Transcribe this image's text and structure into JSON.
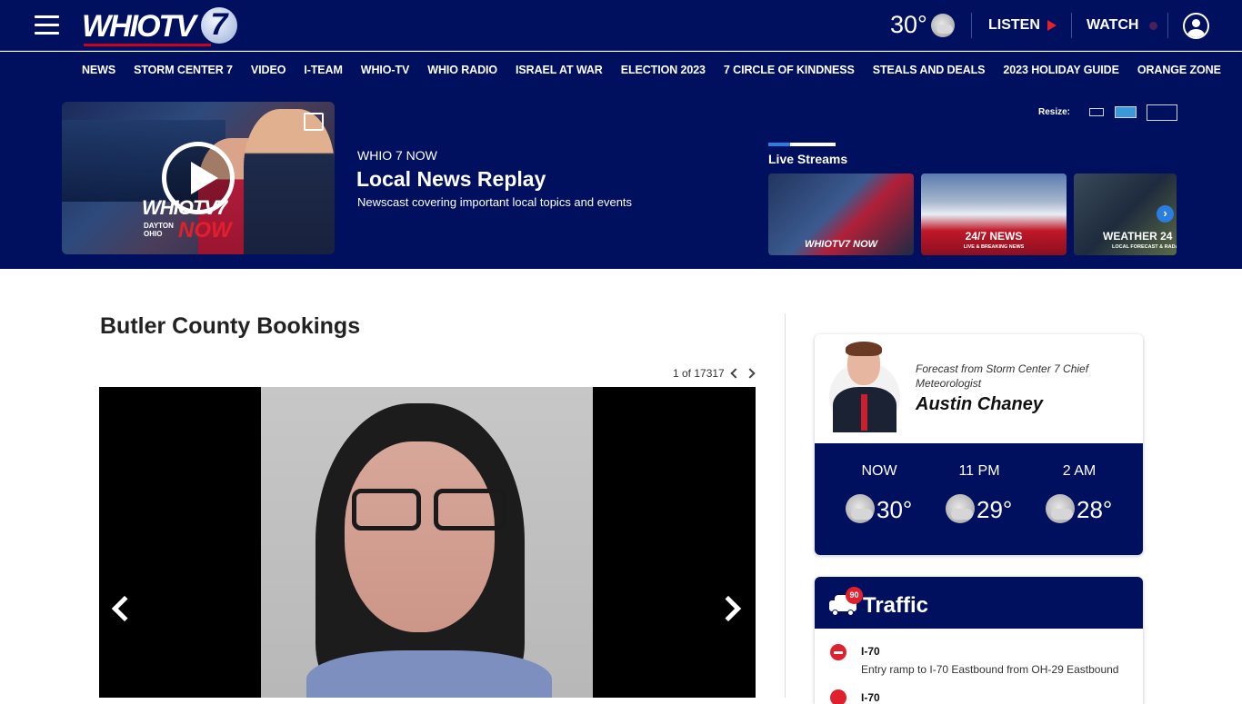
{
  "header": {
    "logo_text": "WHIOTV",
    "logo_number": "7",
    "temperature": "30°",
    "listen_label": "LISTEN",
    "watch_label": "WATCH",
    "accent_color": "#e5202a",
    "bg_color": "#00105e"
  },
  "nav": {
    "items": [
      "NEWS",
      "STORM CENTER 7",
      "VIDEO",
      "I-TEAM",
      "WHIO-TV",
      "WHIO RADIO",
      "ISRAEL AT WAR",
      "ELECTION 2023",
      "7 CIRCLE OF KINDNESS",
      "STEALS AND DEALS",
      "2023 HOLIDAY GUIDE",
      "ORANGE ZONE"
    ]
  },
  "hero": {
    "kicker": "WHIO 7 NOW",
    "title": "Local News Replay",
    "description": "Newscast covering important local topics and events",
    "thumb_brand": "WHIOTV7",
    "thumb_now": "NOW",
    "thumb_city": "DAYTON OHIO",
    "resize_label": "Resize:",
    "live_streams_title": "Live Streams",
    "streams": [
      {
        "label": "WHIOTV7 NOW",
        "sub": ""
      },
      {
        "label": "24/7 NEWS",
        "sub": "LIVE & BREAKING NEWS"
      },
      {
        "label": "WEATHER 24",
        "sub": "LOCAL FORECAST & RADAR"
      }
    ]
  },
  "main": {
    "title": "Butler County Bookings",
    "counter": "1 of 17317"
  },
  "forecast": {
    "kicker": "Forecast from Storm Center 7 Chief Meteorologist",
    "name": "Austin Chaney",
    "periods": [
      {
        "time": "NOW",
        "temp": "30°",
        "icon": "partly-cloudy-night-icon"
      },
      {
        "time": "11 PM",
        "temp": "29°",
        "icon": "partly-cloudy-night-icon"
      },
      {
        "time": "2 AM",
        "temp": "28°",
        "icon": "partly-cloudy-night-icon"
      }
    ]
  },
  "traffic": {
    "title": "Traffic",
    "badge_count": "90",
    "items": [
      {
        "road": "I-70",
        "description": "Entry ramp to I-70 Eastbound from OH-29 Eastbound"
      },
      {
        "road": "I-70",
        "description": ""
      }
    ]
  }
}
